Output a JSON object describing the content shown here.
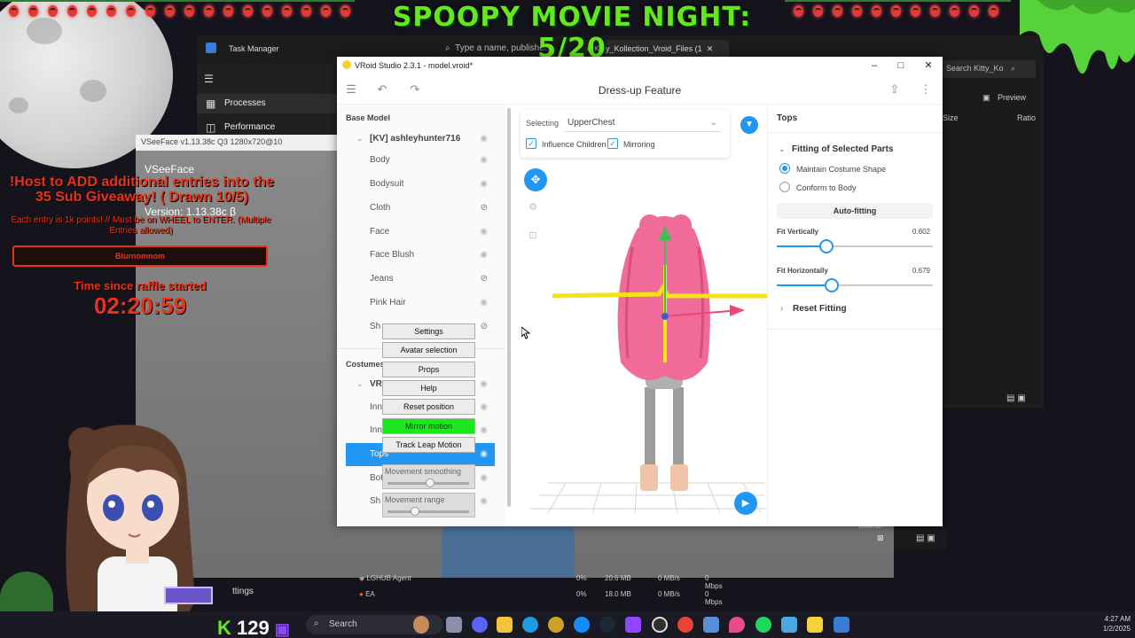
{
  "overlay": {
    "banner_text": "SPOOPY MOVIE NIGHT: 5/20",
    "giveaway_headline": "!Host to ADD additional entries into the 35 Sub Giveaway! ( Drawn 10/5)",
    "giveaway_rules": "Each entry is 1k points! // Must be on WHEEL to ENTER. (Multiple Entries allowed)",
    "highlight_name": "Blurnomnom",
    "raffle_label": "Time since raffle started",
    "raffle_timer": "02:20:59",
    "counter_value": "129"
  },
  "task_manager": {
    "title": "Task Manager",
    "search_placeholder": "Type a name, publisher,",
    "nav": [
      "Processes",
      "Performance"
    ],
    "explorer_tab": "Kitty_Kollection_Vroid_Files (1",
    "explorer_search": "Search Kitty_Ko",
    "preview_label": "Preview",
    "col_size": "Size",
    "col_ratio": "Ratio",
    "rows": [
      {
        "name": "LGHUB Agent",
        "cpu": "0%",
        "mem": "20.6 MB",
        "disk": "0 MB/s",
        "net": "0 Mbps"
      },
      {
        "name": "EA",
        "cpu": "0%",
        "mem": "18.0 MB",
        "disk": "0 MB/s",
        "net": "0 Mbps"
      }
    ],
    "settings_partial": "ttings"
  },
  "vseeface": {
    "titlebar": "VSeeFace v1.13.38c Q3 1280x720@10",
    "app_title": "VSeeFace",
    "version": "Version: 1.13.38c β",
    "size_readout": "1280x720",
    "menu": {
      "settings": "Settings",
      "avatar_selection": "Avatar selection",
      "props": "Props",
      "help": "Help",
      "reset_position": "Reset position",
      "mirror_motion": "Mirror motion",
      "track_leap": "Track Leap Motion",
      "movement_smoothing": "Movement smoothing",
      "movement_range": "Movement range",
      "movement_smoothing_value": 0.52,
      "movement_range_value": 0.33
    }
  },
  "vroid": {
    "window_title": "VRoid Studio 2.3.1 - model.vroid*",
    "page_title": "Dress-up Feature",
    "left": {
      "base_model_label": "Base Model",
      "base_model_root": "[KV] ashleyhunter716",
      "base_items": [
        "Body",
        "Bodysuit",
        "Cloth",
        "Face",
        "Face Blush",
        "Jeans",
        "Pink Hair",
        "Sh"
      ],
      "costumes_label": "Costumes",
      "costume_root": "VR",
      "costume_items": [
        "Inn",
        "Inn",
        "Tops",
        "Bot",
        "Sh"
      ],
      "selected_item": "Tops"
    },
    "viewport": {
      "selecting_label": "Selecting",
      "selecting_value": "UpperChest",
      "influence_children_label": "Influence Children",
      "influence_children_checked": true,
      "mirroring_label": "Mirroring",
      "mirroring_checked": true
    },
    "right": {
      "section": "Tops",
      "fitting_title": "Fitting of Selected Parts",
      "option_maintain": "Maintain Costume Shape",
      "option_conform": "Conform to Body",
      "selected_option": "Maintain Costume Shape",
      "autofit_label": "Auto-fitting",
      "fit_vertically_label": "Fit Vertically",
      "fit_vertically_value": "0.602",
      "fit_horizontally_label": "Fit Horizontally",
      "fit_horizontally_value": "0.679",
      "reset_fitting_label": "Reset Fitting"
    }
  },
  "taskbar": {
    "search_placeholder": "Search",
    "time": "4:27 AM",
    "date": "1/2/2025",
    "icons": [
      "file-explorer-icon",
      "discord-icon",
      "folder-icon",
      "edge-icon",
      "wow-icon",
      "battlenet-icon",
      "steam-icon",
      "w-app-icon",
      "obs-icon",
      "chrome-icon",
      "v-app-icon",
      "maps-pin-icon",
      "spotify-icon",
      "photos-icon",
      "vroid-icon",
      "sniping-icon"
    ]
  },
  "colors": {
    "accent": "#2196f3",
    "banner_green": "#62e91c",
    "overlay_red": "#e8331a",
    "mirror_green": "#1ee51e",
    "hair_pink": "#f06b9a"
  }
}
